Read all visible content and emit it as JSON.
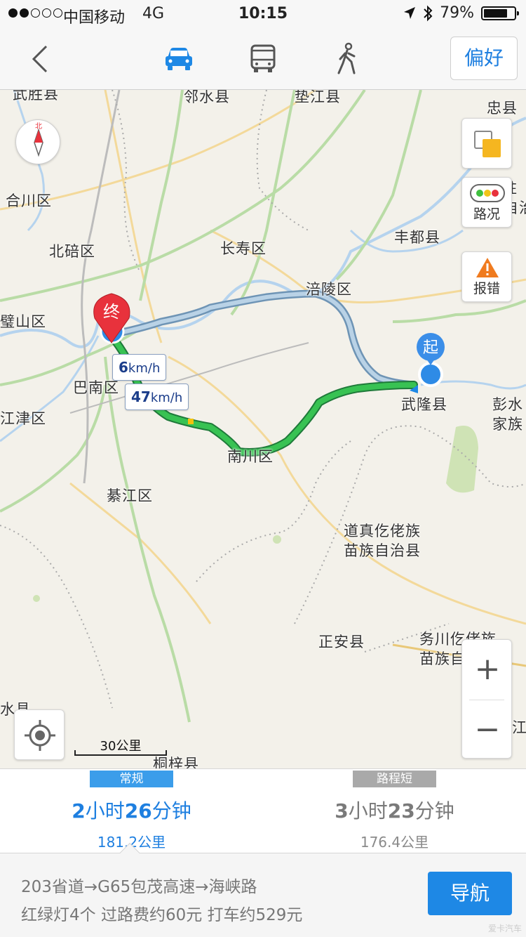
{
  "status_bar": {
    "carrier": "中国移动",
    "network": "4G",
    "time": "10:15",
    "battery": "79%",
    "battery_level": 0.79,
    "signal_strength": 2
  },
  "nav": {
    "preference_label": "偏好",
    "modes": [
      "car",
      "bus",
      "walk"
    ],
    "active_mode": "car"
  },
  "map": {
    "places": [
      {
        "name": "武胜县",
        "pos": "a"
      },
      {
        "name": "邻水县",
        "pos": "b"
      },
      {
        "name": "垫江县",
        "pos": "c"
      },
      {
        "name": "忠县",
        "pos": "d"
      },
      {
        "name": "石柱",
        "pos": "e"
      },
      {
        "name": "合川区",
        "pos": "f"
      },
      {
        "name": "丰都县",
        "pos": "g"
      },
      {
        "name": "北碚区",
        "pos": "h"
      },
      {
        "name": "长寿区",
        "pos": "i"
      },
      {
        "name": "涪陵区",
        "pos": "j"
      },
      {
        "name": "璧山区",
        "pos": "k"
      },
      {
        "name": "巴南区",
        "pos": "l"
      },
      {
        "name": "武隆县",
        "pos": "m"
      },
      {
        "name": "彭水",
        "pos": "n"
      },
      {
        "name": "家族",
        "pos": "o"
      },
      {
        "name": "江津区",
        "pos": "p"
      },
      {
        "name": "南川区",
        "pos": "q"
      },
      {
        "name": "綦江区",
        "pos": "r"
      },
      {
        "name": "道真仡佬族",
        "pos": "s"
      },
      {
        "name": "苗族自治县",
        "pos": "t"
      },
      {
        "name": "正安县",
        "pos": "u"
      },
      {
        "name": "务川仡佬族",
        "pos": "v"
      },
      {
        "name": "苗族自治县",
        "pos": "w"
      },
      {
        "name": "水县",
        "pos": "x"
      },
      {
        "name": "桐梓县",
        "pos": "y"
      },
      {
        "name": "自治",
        "pos": "z"
      },
      {
        "name": "江",
        "pos": "z2"
      }
    ],
    "compass_label": "北",
    "traffic_label": "路况",
    "report_label": "报错",
    "zoom_in": "+",
    "zoom_out": "−",
    "scale_label": "30公里",
    "start_marker": "起",
    "end_marker": "终",
    "speed_labels": [
      {
        "value": "6",
        "unit": "km/h"
      },
      {
        "value": "47",
        "unit": "km/h"
      }
    ]
  },
  "routes": [
    {
      "tag": "常规",
      "hours": "2",
      "hours_unit": "小时",
      "minutes": "26",
      "minutes_unit": "分钟",
      "distance": "181.2公里",
      "selected": true
    },
    {
      "tag": "路程短",
      "hours": "3",
      "hours_unit": "小时",
      "minutes": "23",
      "minutes_unit": "分钟",
      "distance": "176.4公里",
      "selected": false
    }
  ],
  "detail": {
    "path": "203省道→G65包茂高速→海峡路",
    "info": "红绿灯4个  过路费约60元  打车约529元",
    "navigate_label": "导航"
  },
  "watermark": "爱卡汽车",
  "colors": {
    "accent": "#1e88e5",
    "route_fast": "#2db34a",
    "route_slow": "#7aa6c8",
    "end_marker": "#e8323c",
    "start_marker": "#1e7fe0"
  }
}
